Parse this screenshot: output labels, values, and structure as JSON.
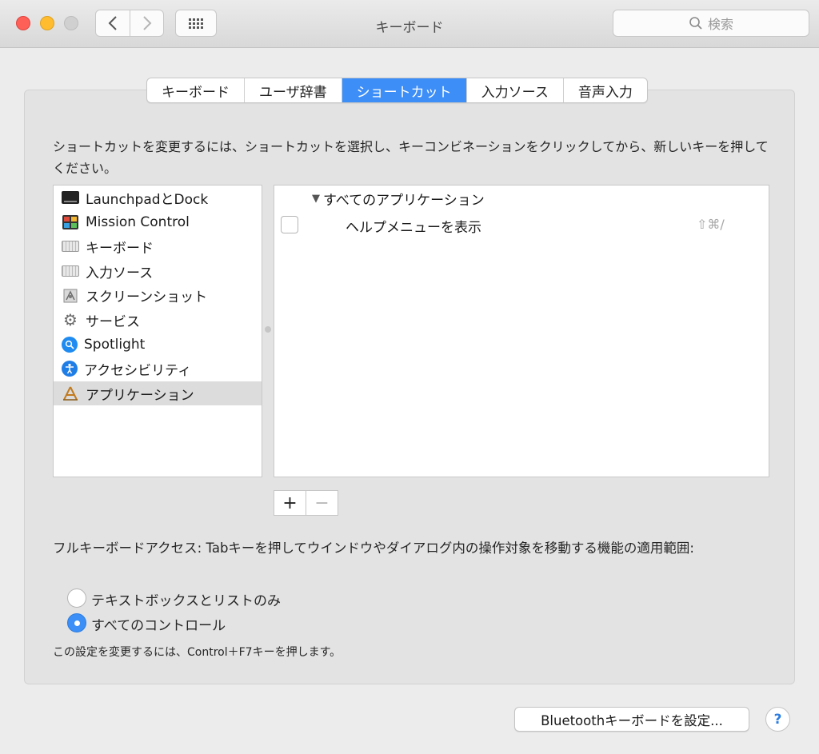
{
  "window": {
    "title": "キーボード",
    "search_placeholder": "検索"
  },
  "toolbar": {
    "back_glyph": "〈",
    "forward_glyph": "〉"
  },
  "tabs": [
    {
      "label": "キーボード",
      "active": false
    },
    {
      "label": "ユーザ辞書",
      "active": false
    },
    {
      "label": "ショートカット",
      "active": true
    },
    {
      "label": "入力ソース",
      "active": false
    },
    {
      "label": "音声入力",
      "active": false
    }
  ],
  "description": "ショートカットを変更するには、ショートカットを選択し、キーコンビネーションをクリックしてから、新しいキーを押してください。",
  "categories": [
    {
      "label": "LaunchpadとDock",
      "icon": "launchpad-dock-icon"
    },
    {
      "label": "Mission Control",
      "icon": "mission-control-icon"
    },
    {
      "label": "キーボード",
      "icon": "keyboard-icon"
    },
    {
      "label": "入力ソース",
      "icon": "input-source-icon"
    },
    {
      "label": "スクリーンショット",
      "icon": "screenshot-icon"
    },
    {
      "label": "サービス",
      "icon": "gear-icon"
    },
    {
      "label": "Spotlight",
      "icon": "spotlight-icon"
    },
    {
      "label": "アクセシビリティ",
      "icon": "accessibility-icon"
    },
    {
      "label": "アプリケーション",
      "icon": "applications-icon",
      "selected": true
    }
  ],
  "shortcuts": {
    "group_label": "すべてのアプリケーション",
    "disclosure_glyph": "▼",
    "items": [
      {
        "label": "ヘルプメニューを表示",
        "keys": "⇧⌘/",
        "checked": false
      }
    ]
  },
  "list_buttons": {
    "add": "+",
    "remove": "−"
  },
  "full_keyboard_access": {
    "label": "フルキーボードアクセス: Tabキーを押してウインドウやダイアログ内の操作対象を移動する機能の適用範囲:",
    "options": [
      {
        "label": "テキストボックスとリストのみ",
        "selected": false
      },
      {
        "label": "すべてのコントロール",
        "selected": true
      }
    ],
    "note": "この設定を変更するには、Control＋F7キーを押します。"
  },
  "footer": {
    "bluetooth_button": "Bluetoothキーボードを設定...",
    "help_button": "?"
  },
  "colors": {
    "accent": "#3e8ef7",
    "close": "#fe5f57",
    "minimize": "#febc2e"
  }
}
